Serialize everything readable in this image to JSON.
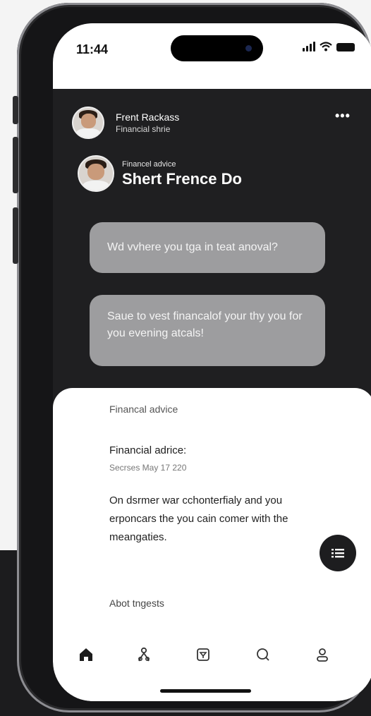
{
  "status_bar": {
    "time": "11:44"
  },
  "header": {
    "name": "Frent Rackass",
    "subtitle": "Financial shrie",
    "more_label": "•••"
  },
  "profile": {
    "label": "Financel advice",
    "title": "Shert Frence Do"
  },
  "messages": [
    {
      "text": "Wd vvhere you tga in teat anoval?"
    },
    {
      "text": "Saue to vest financalof your thy you for you evening atcals!"
    }
  ],
  "card": {
    "section_label": "Financal advice",
    "entry_title": "Financial adrice:",
    "entry_date": "Secrses May 17 220",
    "body": "On dsrmer war cchonterfialy and you erponcars the you cain comer with the meangaties.",
    "footer_text": "Abot tngests"
  },
  "bottom_nav": [
    {
      "icon": "home-icon",
      "active": true
    },
    {
      "icon": "people-icon",
      "active": false
    },
    {
      "icon": "inbox-icon",
      "active": false
    },
    {
      "icon": "search-icon",
      "active": false
    },
    {
      "icon": "profile-icon",
      "active": false
    }
  ],
  "colors": {
    "dark_background": "#1f1f21",
    "bubble": "#9d9d9f",
    "card": "#ffffff",
    "fab": "#1d1d1f"
  }
}
